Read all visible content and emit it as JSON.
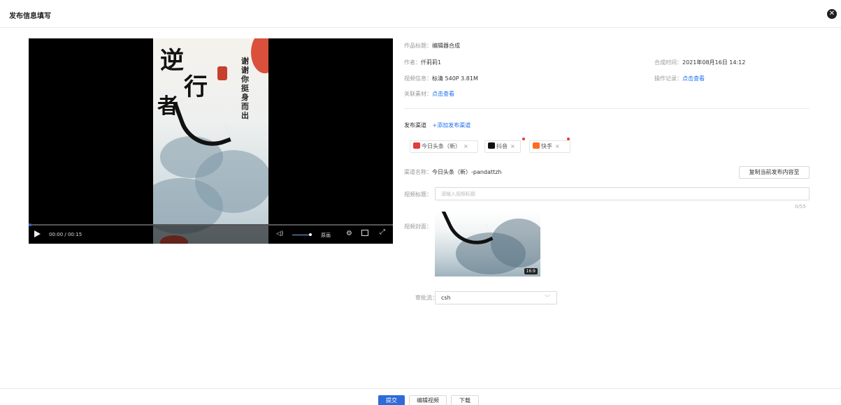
{
  "header": {
    "title": "发布信息填写",
    "close_glyph": "✕"
  },
  "player": {
    "poster_vertical_text": "谢谢你挺身而出",
    "poster_title_chars": [
      "逆",
      "行",
      "者"
    ],
    "time": "00:00 / 00:15",
    "ratio_label": "原画",
    "progress_fraction": 0.0,
    "volume_fraction": 0.6
  },
  "info": {
    "work_title_label": "作品标题：",
    "work_title_value": "编辑器合成",
    "author_label": "作者：",
    "author_value": "仟莉莉1",
    "compose_time_label": "合成时间：",
    "compose_time_value": "2021年08月16日 14:12",
    "video_info_label": "视频信息：",
    "video_info_value": "标清 540P  3.81M",
    "op_record_label": "操作记录：",
    "op_record_link": "点击查看",
    "related_label": "关联素材：",
    "related_link": "点击查看"
  },
  "channels": {
    "label": "发布渠道",
    "add_link": "+添加发布渠道",
    "tabs": [
      {
        "label": "今日头条（新）",
        "icon": "toutiao-icon",
        "color": "#e23c3c"
      },
      {
        "label": "抖音",
        "icon": "douyin-icon",
        "color": "#111111"
      },
      {
        "label": "快手",
        "icon": "kuaishou-icon",
        "color": "#ff6a1f"
      }
    ],
    "close_glyph": "×"
  },
  "form": {
    "channel_name_label": "渠道名称：",
    "channel_name_value": "今日头条（新）-pandattzh",
    "copy_button": "复制当前发布内容至",
    "video_title_label": "视频标题：",
    "video_title_placeholder": "请输入视频标题",
    "video_title_counter": "0/55",
    "cover_label": "视频封面：",
    "cover_ratio": "16:9",
    "approval_label": "审批流：",
    "approval_value": "csh"
  },
  "footer": {
    "submit": "提交",
    "edit_video": "编辑视频",
    "download": "下载"
  },
  "colors": {
    "accent": "#2f6bd8",
    "link": "#1e6ff0",
    "dot": "#e23c3c"
  }
}
